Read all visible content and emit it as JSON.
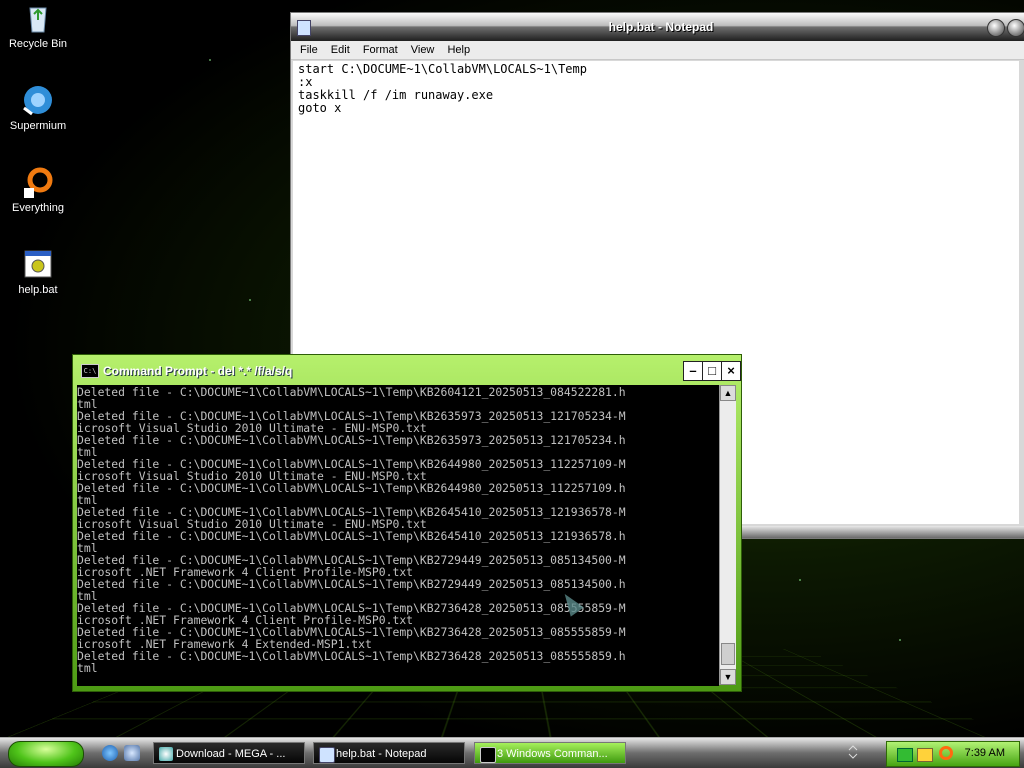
{
  "desktop": {
    "icons": [
      {
        "label": "Recycle Bin"
      },
      {
        "label": "Supermium"
      },
      {
        "label": "Everything"
      },
      {
        "label": "help.bat"
      }
    ]
  },
  "notepad": {
    "title": "help.bat - Notepad",
    "menu": [
      "File",
      "Edit",
      "Format",
      "View",
      "Help"
    ],
    "content": "start C:\\DOCUME~1\\CollabVM\\LOCALS~1\\Temp\n:x\ntaskkill /f /im runaway.exe\ngoto x"
  },
  "cmd": {
    "title": "Command Prompt - del *.* /f/a/s/q",
    "icon_text": "C:\\",
    "lines": [
      "Deleted file - C:\\DOCUME~1\\CollabVM\\LOCALS~1\\Temp\\KB2604121_20250513_084522281.h",
      "tml",
      "Deleted file - C:\\DOCUME~1\\CollabVM\\LOCALS~1\\Temp\\KB2635973_20250513_121705234-M",
      "icrosoft Visual Studio 2010 Ultimate - ENU-MSP0.txt",
      "Deleted file - C:\\DOCUME~1\\CollabVM\\LOCALS~1\\Temp\\KB2635973_20250513_121705234.h",
      "tml",
      "Deleted file - C:\\DOCUME~1\\CollabVM\\LOCALS~1\\Temp\\KB2644980_20250513_112257109-M",
      "icrosoft Visual Studio 2010 Ultimate - ENU-MSP0.txt",
      "Deleted file - C:\\DOCUME~1\\CollabVM\\LOCALS~1\\Temp\\KB2644980_20250513_112257109.h",
      "tml",
      "Deleted file - C:\\DOCUME~1\\CollabVM\\LOCALS~1\\Temp\\KB2645410_20250513_121936578-M",
      "icrosoft Visual Studio 2010 Ultimate - ENU-MSP0.txt",
      "Deleted file - C:\\DOCUME~1\\CollabVM\\LOCALS~1\\Temp\\KB2645410_20250513_121936578.h",
      "tml",
      "Deleted file - C:\\DOCUME~1\\CollabVM\\LOCALS~1\\Temp\\KB2729449_20250513_085134500-M",
      "icrosoft .NET Framework 4 Client Profile-MSP0.txt",
      "Deleted file - C:\\DOCUME~1\\CollabVM\\LOCALS~1\\Temp\\KB2729449_20250513_085134500.h",
      "tml",
      "Deleted file - C:\\DOCUME~1\\CollabVM\\LOCALS~1\\Temp\\KB2736428_20250513_085555859-M",
      "icrosoft .NET Framework 4 Client Profile-MSP0.txt",
      "Deleted file - C:\\DOCUME~1\\CollabVM\\LOCALS~1\\Temp\\KB2736428_20250513_085555859-M",
      "icrosoft .NET Framework 4 Extended-MSP1.txt",
      "Deleted file - C:\\DOCUME~1\\CollabVM\\LOCALS~1\\Temp\\KB2736428_20250513_085555859.h",
      "tml"
    ]
  },
  "taskbar": {
    "tasks": [
      {
        "label": "Download - MEGA - ..."
      },
      {
        "label": "help.bat - Notepad"
      },
      {
        "label": "3 Windows Comman..."
      }
    ],
    "clock": "7:39 AM"
  },
  "colors": {
    "accent_green": "#4fc41a",
    "console_bg": "#000000",
    "console_fg": "#c0c0c0"
  }
}
